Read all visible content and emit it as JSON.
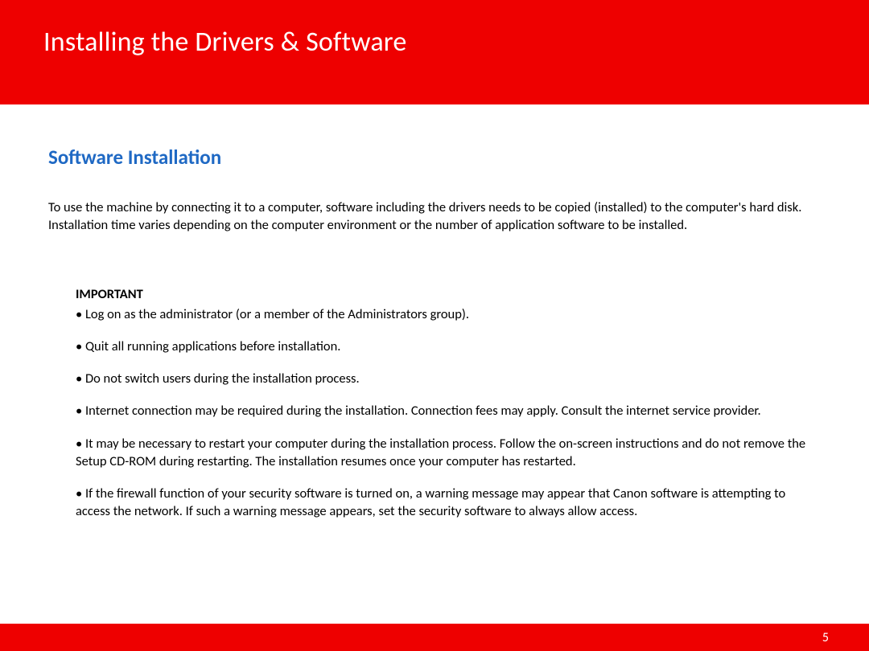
{
  "header": {
    "title": "Installing  the Drivers & Software"
  },
  "section": {
    "title": "Software Installation",
    "intro": "To use the machine by connecting it to a computer, software including the drivers needs to be copied (installed) to the computer's hard disk. Installation time varies depending on the computer environment or the number of application software to be installed."
  },
  "important": {
    "label": "IMPORTANT",
    "items": [
      "• Log on as the administrator (or a member of the Administrators group).",
      "• Quit all running applications before installation.",
      "• Do not switch users during the installation process.",
      "• Internet connection may be required during the installation. Connection fees may apply. Consult the internet service provider.",
      "• It may be necessary to restart your computer during the installation process. Follow the on-screen instructions and do not remove the Setup CD-ROM during restarting. The installation resumes once your computer has restarted.",
      "• If the firewall function of your security software is turned on, a warning message may appear that Canon software is attempting to access the network. If such a warning message appears, set the security software to always allow access."
    ]
  },
  "footer": {
    "page_number": "5"
  }
}
